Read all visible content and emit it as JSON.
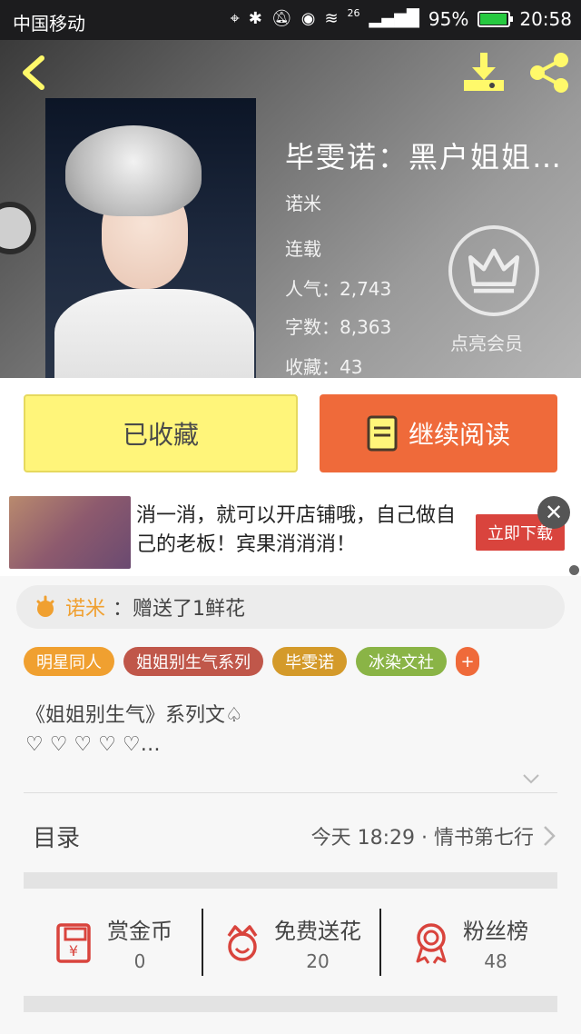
{
  "status_bar": {
    "carrier": "中国移动",
    "network": "26",
    "battery": "95%",
    "battery_level": 0.95,
    "time": "20:58"
  },
  "header": {
    "back_icon": "back-arrow-icon",
    "download_icon": "download-icon",
    "share_icon": "share-icon"
  },
  "book": {
    "title": "毕雯诺：黑户姐姐…",
    "author": "诺米",
    "status": "连载",
    "popularity": "人气：2,743",
    "word_count": "字数：8,363",
    "favorites": "收藏：43",
    "vip_label": "点亮会员"
  },
  "actions": {
    "favorite_label": "已收藏",
    "read_label": "继续阅读"
  },
  "ad": {
    "text": "消一消，就可以开店铺哦，自己做自己的老板！宾果消消消！",
    "button": "立即下载"
  },
  "gift": {
    "user": "诺米",
    "message": "：赠送了1鲜花"
  },
  "tags": [
    {
      "label": "明星同人",
      "color": "#f0a030"
    },
    {
      "label": "姐姐别生气系列",
      "color": "#c0574a"
    },
    {
      "label": "毕雯诺",
      "color": "#d49a2a"
    },
    {
      "label": "冰染文社",
      "color": "#8ab446"
    },
    {
      "label": "+",
      "color": "#ef6a3a"
    }
  ],
  "description": {
    "line1": "《姐姐别生气》系列文♤",
    "line2": "♡ ♡ ♡ ♡ ♡…"
  },
  "toc": {
    "label": "目录",
    "latest": "今天 18:29 · 情书第七行"
  },
  "stats": [
    {
      "label": "赏金币",
      "value": "0",
      "icon": "reward-coin-icon"
    },
    {
      "label": "免费送花",
      "value": "20",
      "icon": "flower-icon"
    },
    {
      "label": "粉丝榜",
      "value": "48",
      "icon": "medal-icon"
    }
  ],
  "colors": {
    "accent_orange": "#ef6a3a",
    "accent_yellow": "#fff57a",
    "gift_user": "#f0a030",
    "icon_red": "#d9443d"
  }
}
